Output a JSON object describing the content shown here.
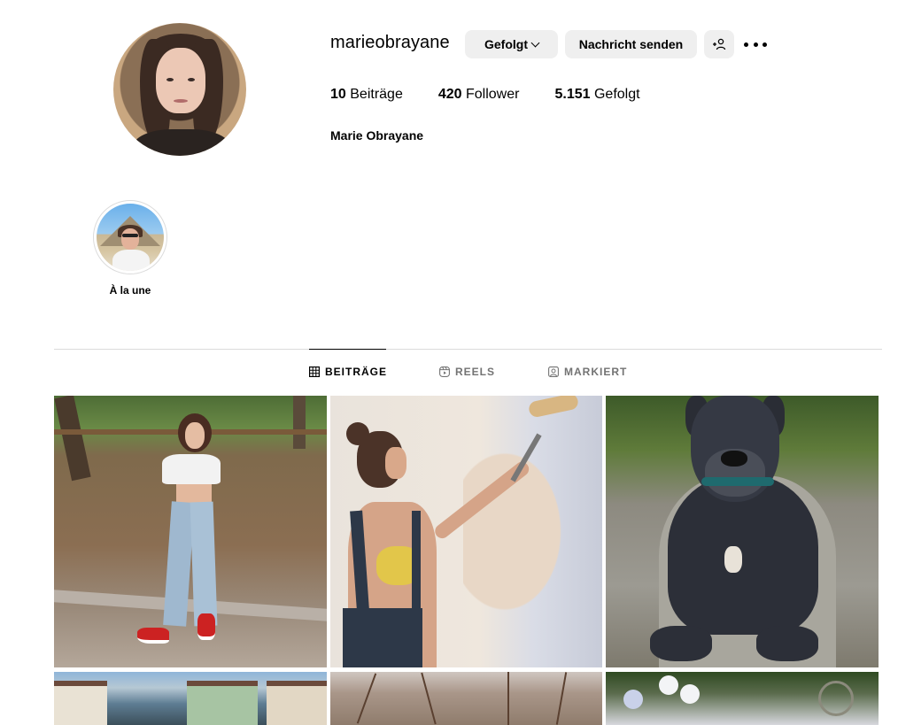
{
  "profile": {
    "username": "marieobrayane",
    "full_name": "Marie Obrayane",
    "following_button": "Gefolgt",
    "message_button": "Nachricht senden",
    "stats": {
      "posts_count": "10",
      "posts_label": "Beiträge",
      "followers_count": "420",
      "followers_label": "Follower",
      "following_count": "5.151",
      "following_label": "Gefolgt"
    }
  },
  "highlights": [
    {
      "label": "À la une"
    }
  ],
  "tabs": [
    {
      "label": "BEITRÄGE",
      "icon": "grid-icon",
      "active": true
    },
    {
      "label": "REELS",
      "icon": "reels-icon",
      "active": false
    },
    {
      "label": "MARKIERT",
      "icon": "tagged-icon",
      "active": false
    }
  ],
  "posts": [
    {
      "description_icon": "photo-woman-forest"
    },
    {
      "description_icon": "photo-woman-painting-wall"
    },
    {
      "description_icon": "photo-great-dane"
    },
    {
      "description_icon": "photo-old-town-houses"
    },
    {
      "description_icon": "photo-bare-branches"
    },
    {
      "description_icon": "photo-white-flowers"
    }
  ],
  "colors": {
    "button_bg": "#efefef",
    "divider": "#dbdbdb",
    "tab_inactive": "#737373"
  }
}
